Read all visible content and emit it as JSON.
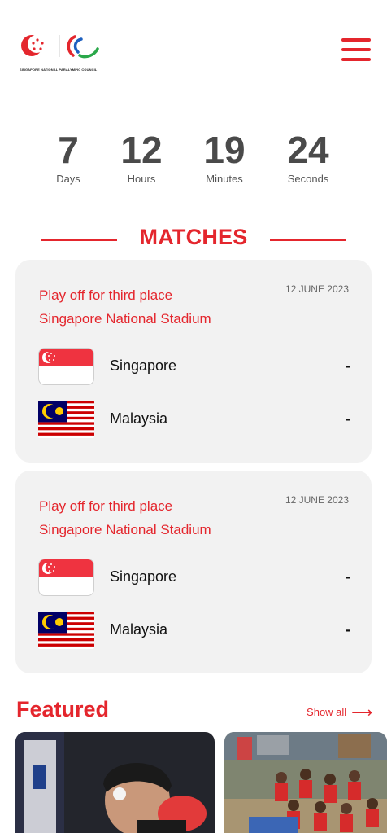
{
  "header": {
    "logo_caption": "SINGAPORE NATIONAL PARALYMPIC COUNCIL",
    "menu_icon": "hamburger-menu-icon",
    "accent_color": "#e4262d"
  },
  "countdown": {
    "days": "7",
    "days_label": "Days",
    "hours": "12",
    "hours_label": "Hours",
    "minutes": "19",
    "minutes_label": "Minutes",
    "seconds": "24",
    "seconds_label": "Seconds"
  },
  "matches": {
    "heading": "MATCHES",
    "items": [
      {
        "title": "Play off for third place",
        "venue": "Singapore National Stadium",
        "date": "12 JUNE 2023",
        "teams": [
          {
            "name": "Singapore",
            "score": "-",
            "flag": "singapore-flag-icon"
          },
          {
            "name": "Malaysia",
            "score": "-",
            "flag": "malaysia-flag-icon"
          }
        ]
      },
      {
        "title": "Play off for third place",
        "venue": "Singapore National Stadium",
        "date": "12 JUNE 2023",
        "teams": [
          {
            "name": "Singapore",
            "score": "-",
            "flag": "singapore-flag-icon"
          },
          {
            "name": "Malaysia",
            "score": "-",
            "flag": "malaysia-flag-icon"
          }
        ]
      }
    ]
  },
  "featured": {
    "heading": "Featured",
    "show_all_label": "Show all",
    "arrow_icon": "arrow-right-icon"
  }
}
